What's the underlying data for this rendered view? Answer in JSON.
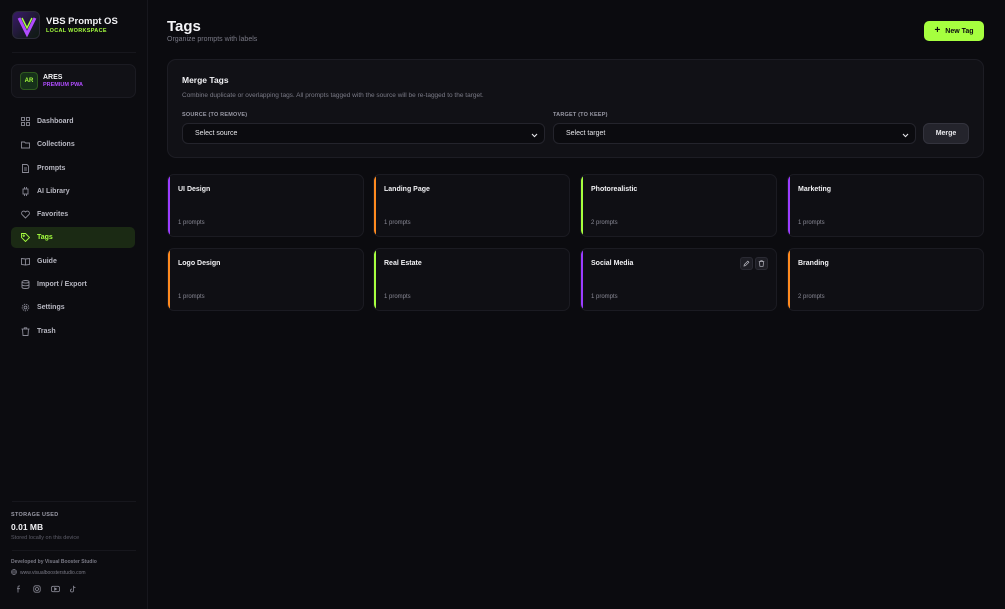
{
  "brand": {
    "title": "VBS Prompt OS",
    "subtitle": "LOCAL WORKSPACE"
  },
  "user": {
    "initials": "AR",
    "name": "ARES",
    "plan": "PREMIUM PWA"
  },
  "nav": [
    {
      "label": "Dashboard",
      "icon": "grid-icon"
    },
    {
      "label": "Collections",
      "icon": "folder-icon"
    },
    {
      "label": "Prompts",
      "icon": "document-icon"
    },
    {
      "label": "AI Library",
      "icon": "chip-icon"
    },
    {
      "label": "Favorites",
      "icon": "heart-icon"
    },
    {
      "label": "Tags",
      "icon": "tag-icon",
      "active": true
    },
    {
      "label": "Guide",
      "icon": "book-icon"
    },
    {
      "label": "Import / Export",
      "icon": "database-icon"
    },
    {
      "label": "Settings",
      "icon": "gear-icon"
    },
    {
      "label": "Trash",
      "icon": "trash-icon"
    }
  ],
  "storage": {
    "label": "STORAGE USED",
    "value": "0.01 MB",
    "note": "Stored locally on this device"
  },
  "developer": {
    "by": "Developed by Visual Booster Studio",
    "site": "www.visualboosterstudio.com"
  },
  "socials": [
    "facebook-icon",
    "instagram-icon",
    "youtube-icon",
    "tiktok-icon"
  ],
  "header": {
    "title": "Tags",
    "subtitle": "Organize prompts with labels",
    "new_tag_label": "New Tag"
  },
  "merge": {
    "title": "Merge Tags",
    "description": "Combine duplicate or overlapping tags. All prompts tagged with the source will be re-tagged to the target.",
    "source_label": "SOURCE (TO REMOVE)",
    "source_value": "Select source",
    "target_label": "TARGET (TO KEEP)",
    "target_value": "Select target",
    "button_label": "Merge"
  },
  "tags": [
    {
      "name": "UI Design",
      "count": "1 prompts",
      "color": "#9b3dff"
    },
    {
      "name": "Landing Page",
      "count": "1 prompts",
      "color": "#ff8a1f"
    },
    {
      "name": "Photorealistic",
      "count": "2 prompts",
      "color": "#a6ff3f"
    },
    {
      "name": "Marketing",
      "count": "1 prompts",
      "color": "#9b3dff"
    },
    {
      "name": "Logo Design",
      "count": "1 prompts",
      "color": "#ff8a1f"
    },
    {
      "name": "Real Estate",
      "count": "1 prompts",
      "color": "#a6ff3f"
    },
    {
      "name": "Social Media",
      "count": "1 prompts",
      "color": "#9b3dff",
      "hovered": true
    },
    {
      "name": "Branding",
      "count": "2 prompts",
      "color": "#ff8a1f"
    }
  ],
  "colors": {
    "accent": "#a6ff3f",
    "purple": "#b04cff",
    "orange": "#ff8a1f",
    "background": "#0b0b0f"
  }
}
